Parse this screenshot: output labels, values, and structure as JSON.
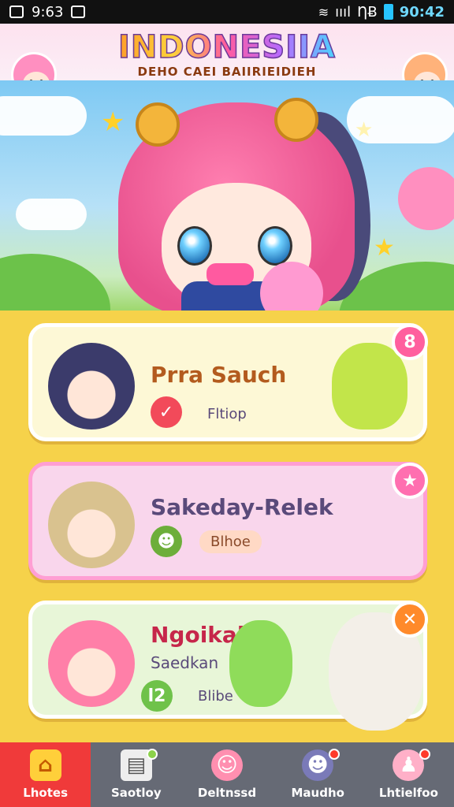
{
  "status_bar": {
    "time_left": "9:63",
    "time_right": "90:42",
    "signal_text": "ıııl",
    "network": "ȠɃ"
  },
  "header": {
    "title": "INDONESIIA",
    "subtitle": "DEHO CAEI BAIIRIEIDIEH"
  },
  "cards": [
    {
      "title": "Prra Sauch",
      "tag": "Fltiop",
      "badge_symbol": "✓",
      "corner_badge": "8"
    },
    {
      "title": "Sakeday-Relek",
      "tag": "Blhoe",
      "badge_symbol": "☻",
      "corner_badge": "★"
    },
    {
      "title": "Ngoikah",
      "subtitle": "Saedkan",
      "tag": "Blibe",
      "badge_symbol": "l2",
      "corner_badge": "✕"
    }
  ],
  "bottom_nav": [
    {
      "label": "Lhotes",
      "icon": "home-icon",
      "active": true
    },
    {
      "label": "Saotloy",
      "icon": "card-icon",
      "active": false
    },
    {
      "label": "Deltnssd",
      "icon": "face-icon",
      "active": false
    },
    {
      "label": "Maudho",
      "icon": "cat-face-icon",
      "active": false
    },
    {
      "label": "Lhtielfoo",
      "icon": "person-icon",
      "active": false
    }
  ],
  "colors": {
    "accent_red": "#f03a3a",
    "background_yellow": "#f6d24a",
    "nav_gray": "#666a75"
  }
}
